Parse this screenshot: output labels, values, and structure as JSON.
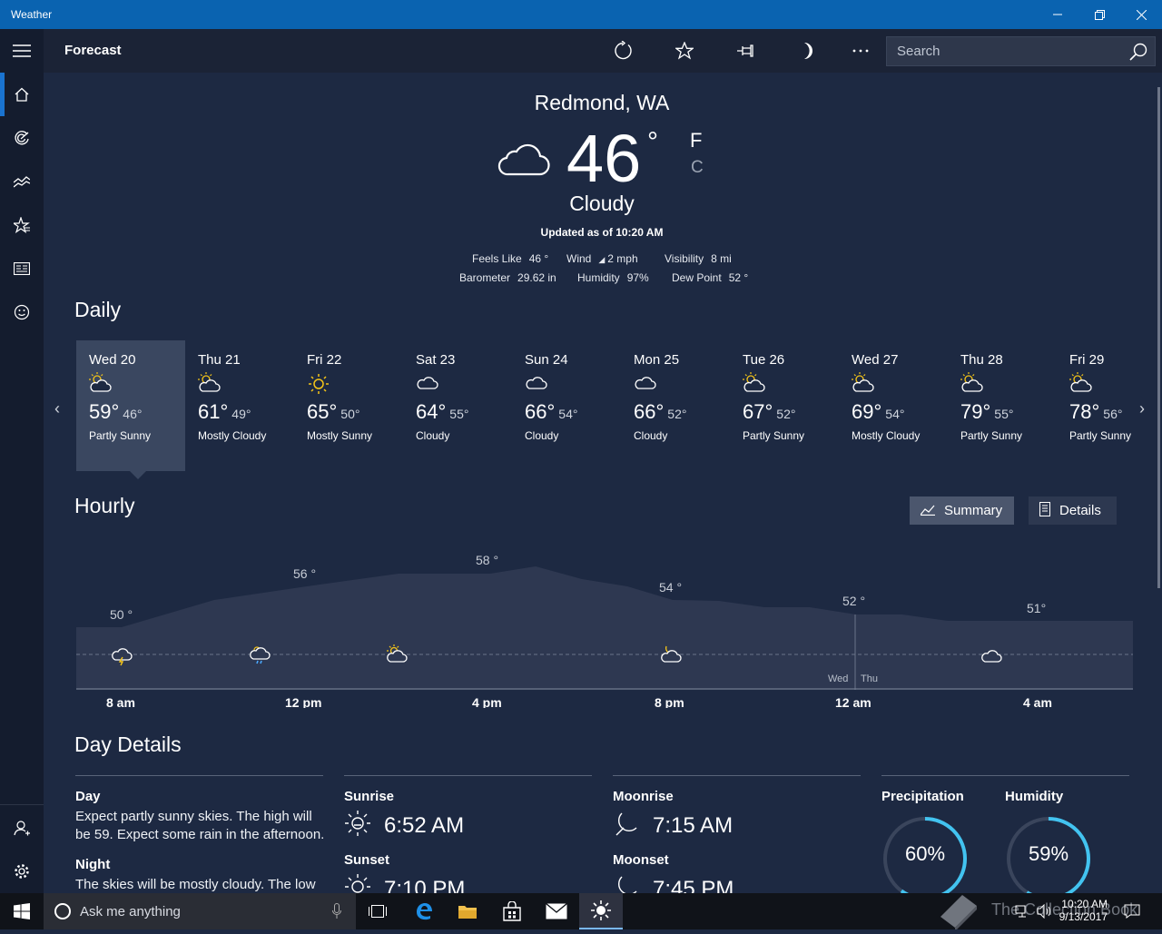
{
  "window": {
    "title": "Weather"
  },
  "header": {
    "title": "Forecast",
    "search_placeholder": "Search"
  },
  "current": {
    "location": "Redmond, WA",
    "temp": "46",
    "deg": "°",
    "unit_f": "F",
    "unit_c": "C",
    "condition": "Cloudy",
    "updated": "Updated as of 10:20 AM",
    "feels_label": "Feels Like",
    "feels": "46 °",
    "wind_label": "Wind",
    "wind": "2 mph",
    "visibility_label": "Visibility",
    "visibility": "8 mi",
    "barometer_label": "Barometer",
    "barometer": "29.62 in",
    "humidity_label": "Humidity",
    "humidity": "97%",
    "dew_label": "Dew Point",
    "dew": "52 °"
  },
  "daily": {
    "title": "Daily",
    "days": [
      {
        "name": "Wed 20",
        "hi": "59°",
        "lo": "46°",
        "cond": "Partly Sunny",
        "icon": "partly-sunny"
      },
      {
        "name": "Thu 21",
        "hi": "61°",
        "lo": "49°",
        "cond": "Mostly Cloudy",
        "icon": "partly-sunny"
      },
      {
        "name": "Fri 22",
        "hi": "65°",
        "lo": "50°",
        "cond": "Mostly Sunny",
        "icon": "sunny"
      },
      {
        "name": "Sat 23",
        "hi": "64°",
        "lo": "55°",
        "cond": "Cloudy",
        "icon": "cloudy"
      },
      {
        "name": "Sun 24",
        "hi": "66°",
        "lo": "54°",
        "cond": "Cloudy",
        "icon": "cloudy"
      },
      {
        "name": "Mon 25",
        "hi": "66°",
        "lo": "52°",
        "cond": "Cloudy",
        "icon": "cloudy"
      },
      {
        "name": "Tue 26",
        "hi": "67°",
        "lo": "52°",
        "cond": "Partly Sunny",
        "icon": "partly-sunny"
      },
      {
        "name": "Wed 27",
        "hi": "69°",
        "lo": "54°",
        "cond": "Mostly Cloudy",
        "icon": "partly-sunny"
      },
      {
        "name": "Thu 28",
        "hi": "79°",
        "lo": "55°",
        "cond": "Partly Sunny",
        "icon": "partly-sunny"
      },
      {
        "name": "Fri 29",
        "hi": "78°",
        "lo": "56°",
        "cond": "Partly Sunny",
        "icon": "partly-sunny"
      }
    ]
  },
  "hourly": {
    "title": "Hourly",
    "summary_label": "Summary",
    "details_label": "Details",
    "temp_labels": [
      "50 °",
      "56 °",
      "58 °",
      "54 °",
      "52 °",
      "51°"
    ],
    "times": [
      "8 am",
      "12 pm",
      "4 pm",
      "8 pm",
      "12 am",
      "4 am"
    ],
    "day_split": [
      "Wed",
      "Thu"
    ]
  },
  "day_details": {
    "title": "Day Details",
    "day_label": "Day",
    "day_text": "Expect partly sunny skies. The high will be 59. Expect some rain in the afternoon.",
    "night_label": "Night",
    "night_text": "The skies will be mostly cloudy. The low",
    "sunrise_label": "Sunrise",
    "sunrise": "6:52 AM",
    "sunset_label": "Sunset",
    "sunset": "7:10 PM",
    "moonrise_label": "Moonrise",
    "moonrise": "7:15 AM",
    "moonset_label": "Moonset",
    "moonset": "7:45 PM",
    "precip_label": "Precipitation",
    "precip": "60%",
    "precip_value": 0.6,
    "humid_label": "Humidity",
    "humid": "59%",
    "humid_value": 0.59
  },
  "taskbar": {
    "search_placeholder": "Ask me anything",
    "time": "10:20 AM",
    "date": "9/13/2017",
    "watermark": "The Collection Book"
  },
  "colors": {
    "accent": "#0a63b0",
    "ring": "#42c3f0",
    "sun": "#f5c518"
  }
}
